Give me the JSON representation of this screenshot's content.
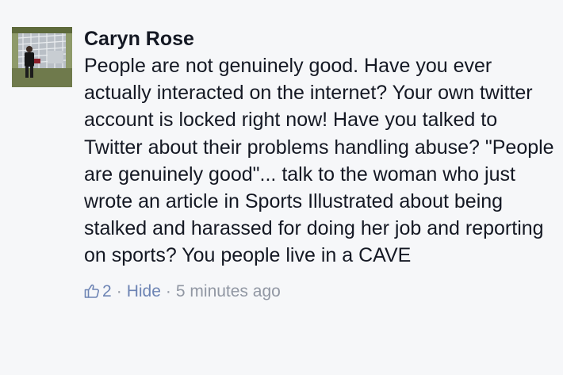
{
  "comment": {
    "author": "Caryn Rose",
    "text": "People are not genuinely good. Have you ever actually interacted on the internet? Your own twitter account is locked right now! Have you talked to Twitter about their problems handling abuse? \"People are genuinely good\"... talk to the woman who just wrote an article in Sports Illustrated about being stalked and harassed for doing her job and reporting on sports? You people live in a CAVE",
    "likes": "2",
    "separator": "·",
    "hide_label": "Hide",
    "timestamp": "5 minutes ago",
    "like_icon": "thumbs-up-icon"
  },
  "colors": {
    "background": "#f6f7f9",
    "text": "#141823",
    "link": "#6d84b4",
    "meta": "#9197a3"
  }
}
